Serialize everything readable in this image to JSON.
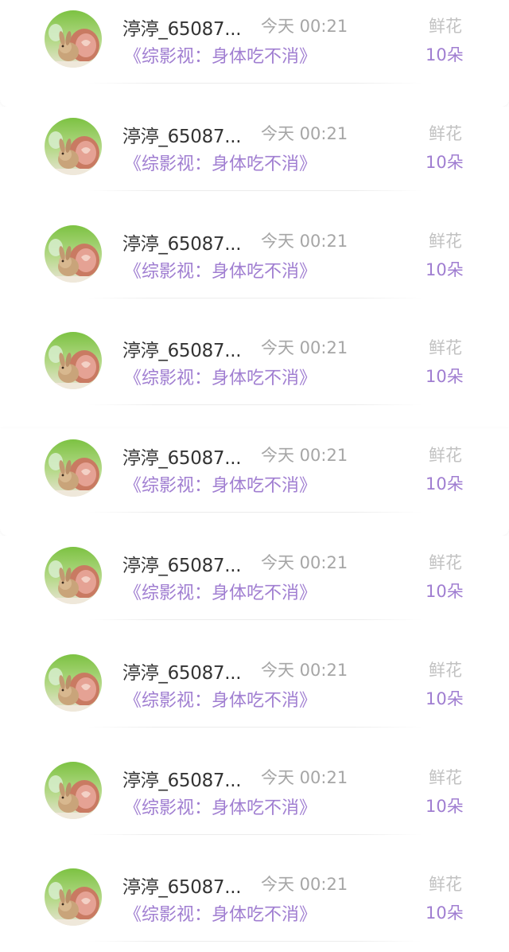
{
  "list": {
    "items": [
      {
        "name": "渟渟_65087...",
        "time": "今天 00:21",
        "work": "《综影视：身体吃不消》",
        "gift": "鲜花",
        "amount": "10朵"
      },
      {
        "name": "渟渟_65087...",
        "time": "今天 00:21",
        "work": "《综影视：身体吃不消》",
        "gift": "鲜花",
        "amount": "10朵"
      },
      {
        "name": "渟渟_65087...",
        "time": "今天 00:21",
        "work": "《综影视：身体吃不消》",
        "gift": "鲜花",
        "amount": "10朵"
      },
      {
        "name": "渟渟_65087...",
        "time": "今天 00:21",
        "work": "《综影视：身体吃不消》",
        "gift": "鲜花",
        "amount": "10朵"
      },
      {
        "name": "渟渟_65087...",
        "time": "今天 00:21",
        "work": "《综影视：身体吃不消》",
        "gift": "鲜花",
        "amount": "10朵"
      },
      {
        "name": "渟渟_65087...",
        "time": "今天 00:21",
        "work": "《综影视：身体吃不消》",
        "gift": "鲜花",
        "amount": "10朵"
      },
      {
        "name": "渟渟_65087...",
        "time": "今天 00:21",
        "work": "《综影视：身体吃不消》",
        "gift": "鲜花",
        "amount": "10朵"
      },
      {
        "name": "渟渟_65087...",
        "time": "今天 00:21",
        "work": "《综影视：身体吃不消》",
        "gift": "鲜花",
        "amount": "10朵"
      },
      {
        "name": "渟渟_65087...",
        "time": "今天 00:21",
        "work": "《综影视：身体吃不消》",
        "gift": "鲜花",
        "amount": "10朵"
      }
    ]
  },
  "colors": {
    "accent": "#a07ed1",
    "name_text": "#333333",
    "muted_text": "#a6a6a6"
  },
  "icons": {
    "avatar": "rabbit-avatar-icon"
  }
}
